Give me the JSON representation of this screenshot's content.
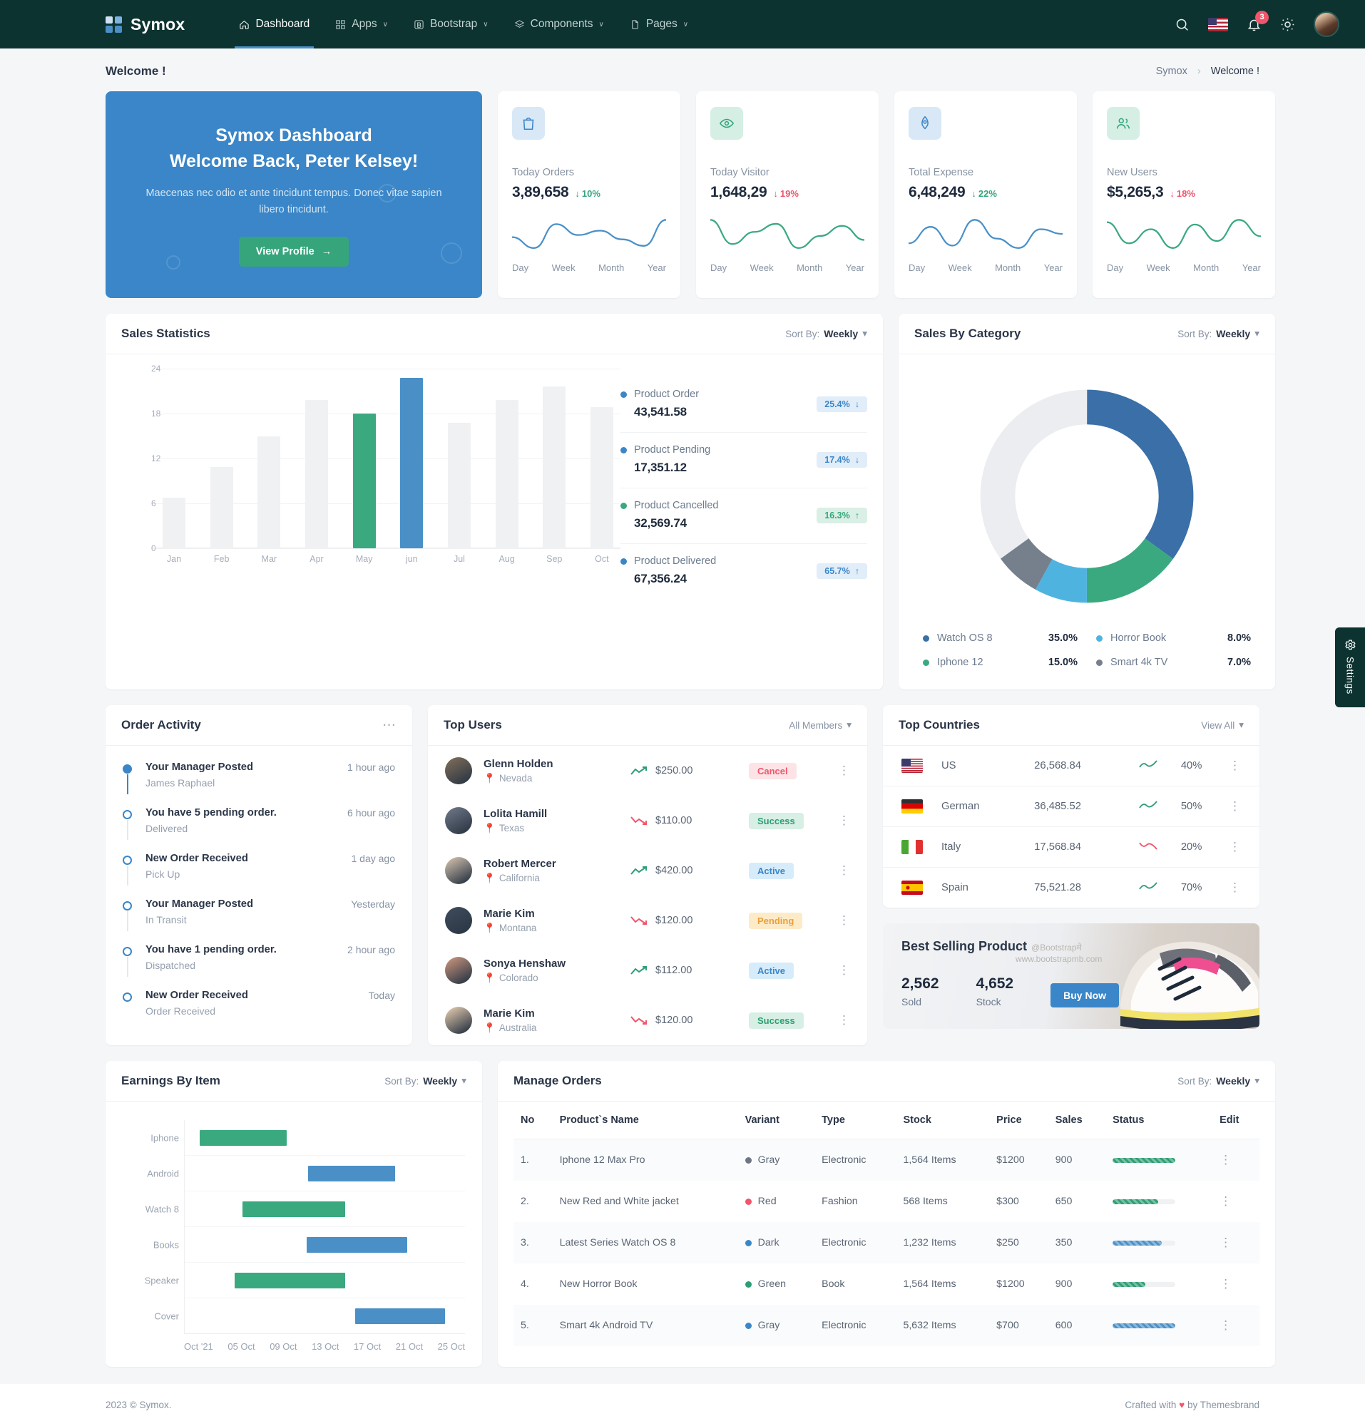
{
  "brand": {
    "name": "Symox"
  },
  "nav": {
    "items": [
      {
        "label": "Dashboard",
        "icon": "dashboard-icon",
        "active": true,
        "caret": false
      },
      {
        "label": "Apps",
        "icon": "apps-icon",
        "active": false,
        "caret": true
      },
      {
        "label": "Bootstrap",
        "icon": "bootstrap-icon",
        "active": false,
        "caret": true
      },
      {
        "label": "Components",
        "icon": "layers-icon",
        "active": false,
        "caret": true
      },
      {
        "label": "Pages",
        "icon": "file-icon",
        "active": false,
        "caret": true
      }
    ],
    "caret_glyph": "∨"
  },
  "topright": {
    "search_icon": "search-icon",
    "flag": "us-flag-icon",
    "bell_icon": "bell-icon",
    "notification_count": "3",
    "theme_icon": "sun-icon",
    "avatar": "user-avatar"
  },
  "page": {
    "title": "Welcome !",
    "breadcrumb": {
      "root": "Symox",
      "separator": "›",
      "current": "Welcome !"
    }
  },
  "welcome": {
    "heading_line1": "Symox Dashboard",
    "heading_line2": "Welcome Back, Peter Kelsey!",
    "body": "Maecenas nec odio et ante tincidunt tempus. Donec vitae sapien libero tincidunt.",
    "cta": "View Profile",
    "cta_arrow": "→"
  },
  "stats": [
    {
      "icon": "shopping-bag-icon",
      "tone": "blue",
      "label": "Today Orders",
      "value": "3,89,658",
      "delta": "10%",
      "direction": "down",
      "delta_tone": "up",
      "tabs": [
        "Day",
        "Week",
        "Month",
        "Year"
      ],
      "line_color": "#4a90c7"
    },
    {
      "icon": "eye-icon",
      "tone": "green",
      "label": "Today Visitor",
      "value": "1,648,29",
      "delta": "19%",
      "direction": "down",
      "delta_tone": "down",
      "tabs": [
        "Day",
        "Week",
        "Month",
        "Year"
      ],
      "line_color": "#3aa980"
    },
    {
      "icon": "rocket-icon",
      "tone": "blue",
      "label": "Total Expense",
      "value": "6,48,249",
      "delta": "22%",
      "direction": "down",
      "delta_tone": "up",
      "tabs": [
        "Day",
        "Week",
        "Month",
        "Year"
      ],
      "line_color": "#4a90c7"
    },
    {
      "icon": "users-icon",
      "tone": "green",
      "label": "New Users",
      "value": "$5,265,3",
      "delta": "18%",
      "direction": "down",
      "delta_tone": "down",
      "tabs": [
        "Day",
        "Week",
        "Month",
        "Year"
      ],
      "line_color": "#3aa980"
    }
  ],
  "sales_statistics": {
    "title": "Sales Statistics",
    "sort_prefix": "Sort By:",
    "sort_value": "Weekly",
    "products": [
      {
        "name": "Product Order",
        "value": "43,541.58",
        "pct": "25.4%",
        "arrow": "↓",
        "tone": "blue",
        "dot": "#3a86c8"
      },
      {
        "name": "Product Pending",
        "value": "17,351.12",
        "pct": "17.4%",
        "arrow": "↓",
        "tone": "blue",
        "dot": "#3a86c8"
      },
      {
        "name": "Product Cancelled",
        "value": "32,569.74",
        "pct": "16.3%",
        "arrow": "↑",
        "tone": "green",
        "dot": "#3aa980"
      },
      {
        "name": "Product Delivered",
        "value": "67,356.24",
        "pct": "65.7%",
        "arrow": "↑",
        "tone": "blue",
        "dot": "#3a86c8"
      }
    ]
  },
  "sales_by_category": {
    "title": "Sales By Category",
    "sort_prefix": "Sort By:",
    "sort_value": "Weekly",
    "legend": [
      {
        "label": "Watch OS 8",
        "value": "35.0%",
        "color": "#3a6fa8"
      },
      {
        "label": "Horror Book",
        "value": "8.0%",
        "color": "#4fb3e0"
      },
      {
        "label": "Iphone 12",
        "value": "15.0%",
        "color": "#3aa980"
      },
      {
        "label": "Smart 4k TV",
        "value": "7.0%",
        "color": "#767f8c"
      }
    ]
  },
  "order_activity": {
    "title": "Order Activity",
    "menu_glyph": "⋯",
    "items": [
      {
        "title": "Your Manager Posted",
        "sub": "James Raphael",
        "time": "1 hour ago"
      },
      {
        "title": "You have 5 pending order.",
        "sub": "Delivered",
        "time": "6 hour ago"
      },
      {
        "title": "New Order Received",
        "sub": "Pick Up",
        "time": "1 day ago"
      },
      {
        "title": "Your Manager Posted",
        "sub": "In Transit",
        "time": "Yesterday"
      },
      {
        "title": "You have 1 pending order.",
        "sub": "Dispatched",
        "time": "2 hour ago"
      },
      {
        "title": "New Order Received",
        "sub": "Order Received",
        "time": "Today"
      }
    ]
  },
  "top_users": {
    "title": "Top Users",
    "filter": "All Members",
    "rows": [
      {
        "name": "Glenn Holden",
        "location": "Nevada",
        "amount": "$250.00",
        "trend": "up",
        "status": "Cancel",
        "status_class": "b-cancel",
        "avatar": "#7a6a58"
      },
      {
        "name": "Lolita Hamill",
        "location": "Texas",
        "amount": "$110.00",
        "trend": "down",
        "status": "Success",
        "status_class": "b-success",
        "avatar": "#6b7383"
      },
      {
        "name": "Robert Mercer",
        "location": "California",
        "amount": "$420.00",
        "trend": "up",
        "status": "Active",
        "status_class": "b-active",
        "avatar": "#c9b9a8"
      },
      {
        "name": "Marie Kim",
        "location": "Montana",
        "amount": "$120.00",
        "trend": "down",
        "status": "Pending",
        "status_class": "b-pending",
        "avatar": "#3c4a5a"
      },
      {
        "name": "Sonya Henshaw",
        "location": "Colorado",
        "amount": "$112.00",
        "trend": "up",
        "status": "Active",
        "status_class": "b-active",
        "avatar": "#c08f7a"
      },
      {
        "name": "Marie Kim",
        "location": "Australia",
        "amount": "$120.00",
        "trend": "down",
        "status": "Success",
        "status_class": "b-success",
        "avatar": "#d9c2a8"
      }
    ]
  },
  "top_countries": {
    "title": "Top Countries",
    "view_all": "View All",
    "rows": [
      {
        "country": "US",
        "flag": "us-flag",
        "value": "26,568.84",
        "trend": "up",
        "pct": "40%"
      },
      {
        "country": "German",
        "flag": "german-flag",
        "value": "36,485.52",
        "trend": "up",
        "pct": "50%"
      },
      {
        "country": "Italy",
        "flag": "italy-flag",
        "value": "17,568.84",
        "trend": "down",
        "pct": "20%"
      },
      {
        "country": "Spain",
        "flag": "spain-flag",
        "value": "75,521.28",
        "trend": "up",
        "pct": "70%"
      }
    ]
  },
  "best_selling": {
    "title": "Best Selling Product",
    "watermark1": "@Bootstrapमे",
    "watermark2": "www.bootstrapmb.com",
    "sold_value": "2,562",
    "sold_label": "Sold",
    "stock_value": "4,652",
    "stock_label": "Stock",
    "cta": "Buy Now"
  },
  "earnings_by_item": {
    "title": "Earnings By Item",
    "sort_prefix": "Sort By:",
    "sort_value": "Weekly"
  },
  "manage_orders": {
    "title": "Manage Orders",
    "sort_prefix": "Sort By:",
    "sort_value": "Weekly",
    "columns": [
      "No",
      "Product`s Name",
      "Variant",
      "Type",
      "Stock",
      "Price",
      "Sales",
      "Status",
      "Edit"
    ],
    "rows": [
      {
        "no": "1.",
        "name": "Iphone 12 Max Pro",
        "variant": "Gray",
        "variant_color": "#6e7583",
        "type": "Electronic",
        "stock": "1,564 Items",
        "price": "$1200",
        "sales": "900",
        "progress": 100,
        "bar_color": "#2e9e74"
      },
      {
        "no": "2.",
        "name": "New Red and White jacket",
        "variant": "Red",
        "variant_color": "#f1556c",
        "type": "Fashion",
        "stock": "568 Items",
        "price": "$300",
        "sales": "650",
        "progress": 72,
        "bar_color": "#2e9e74"
      },
      {
        "no": "3.",
        "name": "Latest Series Watch OS 8",
        "variant": "Dark",
        "variant_color": "#3a86c8",
        "type": "Electronic",
        "stock": "1,232 Items",
        "price": "$250",
        "sales": "350",
        "progress": 78,
        "bar_color": "#4a90c7"
      },
      {
        "no": "4.",
        "name": "New Horror Book",
        "variant": "Green",
        "variant_color": "#2e9e74",
        "type": "Book",
        "stock": "1,564 Items",
        "price": "$1200",
        "sales": "900",
        "progress": 52,
        "bar_color": "#2e9e74"
      },
      {
        "no": "5.",
        "name": "Smart 4k Android TV",
        "variant": "Gray",
        "variant_color": "#3a86c8",
        "type": "Electronic",
        "stock": "5,632 Items",
        "price": "$700",
        "sales": "600",
        "progress": 100,
        "bar_color": "#4a90c7"
      }
    ]
  },
  "footer": {
    "left": "2023 © Symox.",
    "right_pre": "Crafted with",
    "heart": "♥",
    "right_post": "by Themesbrand"
  },
  "settings_tab": {
    "label": "Settings",
    "icon": "gear-icon"
  },
  "chart_data": [
    {
      "type": "bar",
      "title": "Sales Statistics",
      "categories": [
        "Jan",
        "Feb",
        "Mar",
        "Apr",
        "May",
        "jun",
        "Jul",
        "Aug",
        "Sep",
        "Oct"
      ],
      "values": [
        6.8,
        10.9,
        15.0,
        19.8,
        18.0,
        22.8,
        16.8,
        19.8,
        21.6,
        18.9
      ],
      "highlight": {
        "May": "#3aa980",
        "jun": "#4a90c7"
      },
      "base_color": "#f0f1f3",
      "ylim": [
        0,
        24
      ],
      "yticks": [
        0,
        6,
        12,
        18,
        24
      ],
      "xlabel": "",
      "ylabel": "",
      "grid": true,
      "legend": false
    },
    {
      "type": "pie",
      "title": "Sales By Category",
      "variant": "donut",
      "labels": [
        "Watch OS 8",
        "Iphone 12",
        "Horror Book",
        "Smart 4k TV",
        "Other"
      ],
      "values": [
        35.0,
        15.0,
        8.0,
        7.0,
        35.0
      ],
      "colors": [
        "#3a6fa8",
        "#3aa980",
        "#4fb3e0",
        "#767f8c",
        "#ebedf0"
      ],
      "legend": "bottom"
    },
    {
      "type": "bar",
      "variant": "gantt-range",
      "title": "Earnings By Item",
      "categories": [
        "Iphone",
        "Android",
        "Watch 8",
        "Books",
        "Speaker",
        "Cover"
      ],
      "x_ticks": [
        "Oct '21",
        "05 Oct",
        "09 Oct",
        "13 Oct",
        "17 Oct",
        "21 Oct",
        "25 Oct"
      ],
      "ranges": [
        {
          "item": "Iphone",
          "start": 1.5,
          "end": 10.2,
          "color": "#3aa980"
        },
        {
          "item": "Android",
          "start": 12.3,
          "end": 21.0,
          "color": "#4a90c7"
        },
        {
          "item": "Watch 8",
          "start": 5.8,
          "end": 16.0,
          "color": "#3aa980"
        },
        {
          "item": "Books",
          "start": 12.2,
          "end": 22.2,
          "color": "#4a90c7"
        },
        {
          "item": "Speaker",
          "start": 5.0,
          "end": 16.0,
          "color": "#3aa980"
        },
        {
          "item": "Cover",
          "start": 17.0,
          "end": 26.0,
          "color": "#4a90c7"
        }
      ],
      "xlabel": "",
      "ylabel": "",
      "grid": true,
      "legend": false
    },
    {
      "type": "line",
      "variant": "sparkline-set",
      "series": [
        {
          "name": "Today Orders",
          "color": "#4a90c7",
          "values": [
            8,
            3,
            14,
            9,
            11,
            7,
            4,
            16
          ]
        },
        {
          "name": "Today Visitor",
          "color": "#3aa980",
          "values": [
            16,
            4,
            10,
            14,
            2,
            8,
            13,
            6
          ]
        },
        {
          "name": "Total Expense",
          "color": "#4a90c7",
          "values": [
            5,
            12,
            4,
            15,
            7,
            3,
            11,
            9
          ]
        },
        {
          "name": "New Users",
          "color": "#3aa980",
          "values": [
            14,
            5,
            11,
            3,
            13,
            6,
            15,
            8
          ]
        }
      ]
    }
  ]
}
